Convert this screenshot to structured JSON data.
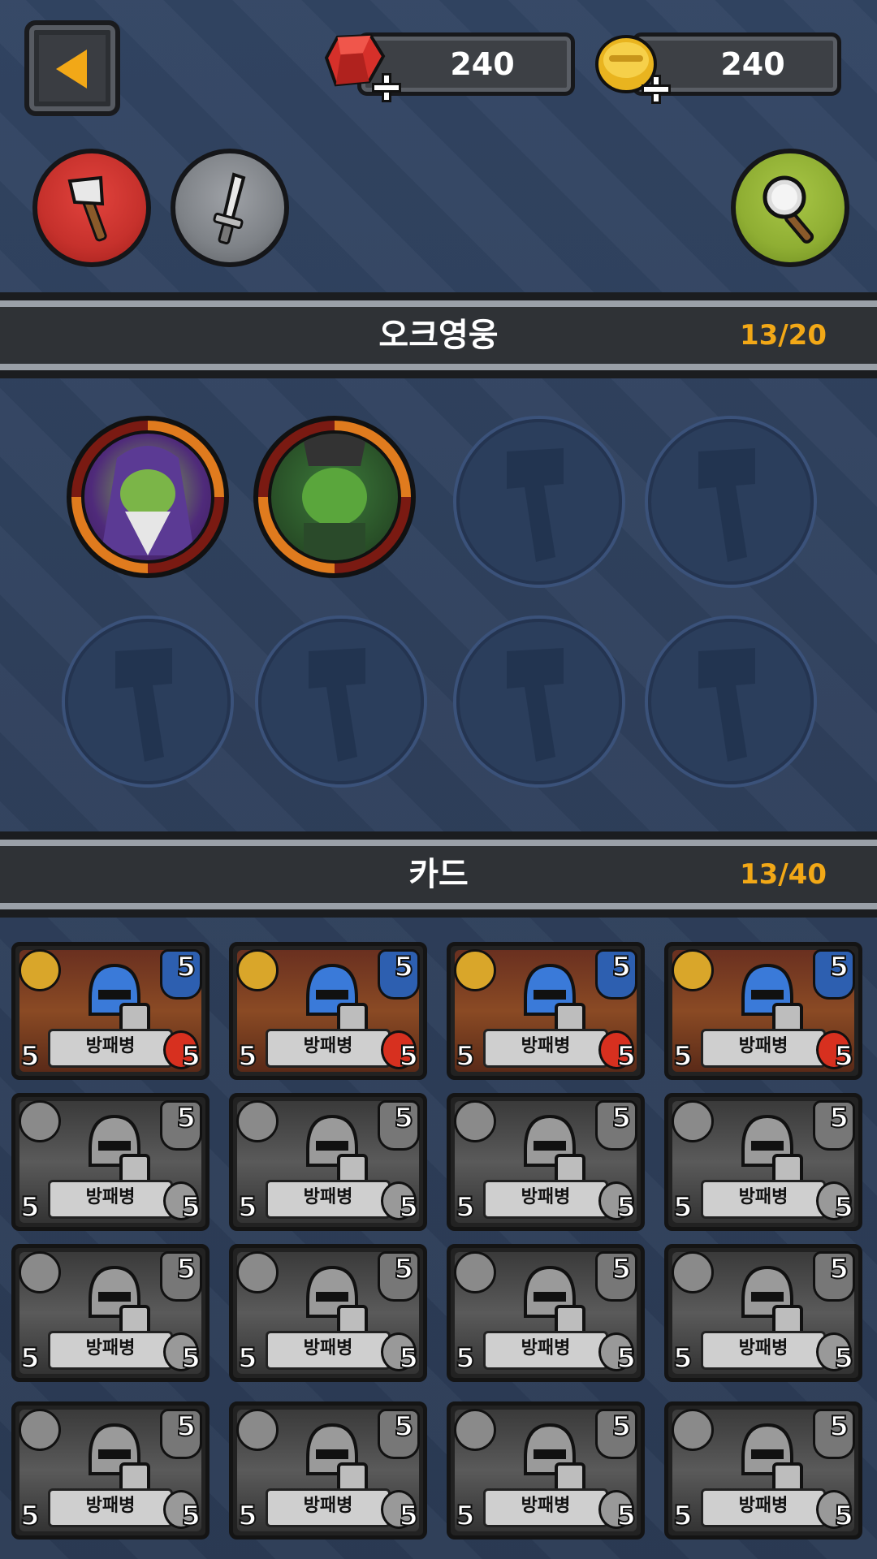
{
  "header": {
    "back_button": "back-arrow-icon",
    "gems": {
      "icon": "gem-icon",
      "value": "240"
    },
    "gold": {
      "icon": "gold-coin-icon",
      "value": "240"
    }
  },
  "filters": {
    "axe": "axe-icon",
    "sword": "sword-icon",
    "search": "magnifier-icon"
  },
  "heroes_section": {
    "title": "오크영웅",
    "count": "13/20"
  },
  "cards_section": {
    "title": "카드",
    "count": "13/40"
  },
  "heroes": [
    {
      "name": "hooded-orc-shaman",
      "owned": true
    },
    {
      "name": "mohawk-orc-warrior",
      "owned": true
    },
    {
      "owned": false
    },
    {
      "owned": false
    },
    {
      "owned": false
    },
    {
      "owned": false
    },
    {
      "owned": false
    },
    {
      "owned": false
    }
  ],
  "cards": [
    {
      "name": "방패병",
      "level": "5",
      "attack": "5",
      "health": "5",
      "owned": true
    },
    {
      "name": "방패병",
      "level": "5",
      "attack": "5",
      "health": "5",
      "owned": true
    },
    {
      "name": "방패병",
      "level": "5",
      "attack": "5",
      "health": "5",
      "owned": true
    },
    {
      "name": "방패병",
      "level": "5",
      "attack": "5",
      "health": "5",
      "owned": true
    },
    {
      "name": "방패병",
      "level": "5",
      "attack": "5",
      "health": "5",
      "owned": false
    },
    {
      "name": "방패병",
      "level": "5",
      "attack": "5",
      "health": "5",
      "owned": false
    },
    {
      "name": "방패병",
      "level": "5",
      "attack": "5",
      "health": "5",
      "owned": false
    },
    {
      "name": "방패병",
      "level": "5",
      "attack": "5",
      "health": "5",
      "owned": false
    },
    {
      "name": "방패병",
      "level": "5",
      "attack": "5",
      "health": "5",
      "owned": false
    },
    {
      "name": "방패병",
      "level": "5",
      "attack": "5",
      "health": "5",
      "owned": false
    },
    {
      "name": "방패병",
      "level": "5",
      "attack": "5",
      "health": "5",
      "owned": false
    },
    {
      "name": "방패병",
      "level": "5",
      "attack": "5",
      "health": "5",
      "owned": false
    },
    {
      "name": "방패병",
      "level": "5",
      "attack": "5",
      "health": "5",
      "owned": false
    },
    {
      "name": "방패병",
      "level": "5",
      "attack": "5",
      "health": "5",
      "owned": false
    },
    {
      "name": "방패병",
      "level": "5",
      "attack": "5",
      "health": "5",
      "owned": false
    },
    {
      "name": "방패병",
      "level": "5",
      "attack": "5",
      "health": "5",
      "owned": false
    }
  ]
}
